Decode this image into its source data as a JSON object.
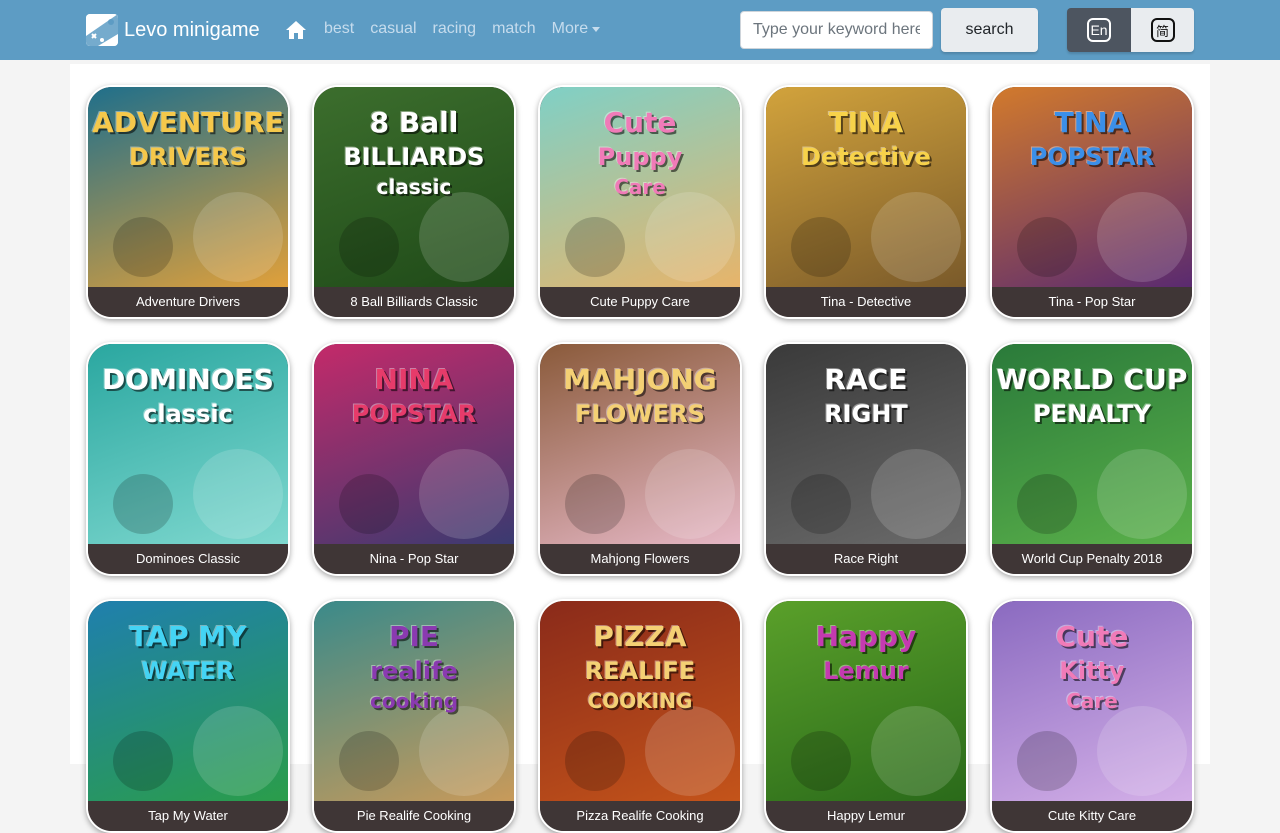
{
  "navbar": {
    "brand": "Levo minigame",
    "links": [
      "best",
      "casual",
      "racing",
      "match"
    ],
    "more_label": "More",
    "search_placeholder": "Type your keyword here",
    "search_button": "search",
    "lang_en": "En",
    "lang_zh": "简"
  },
  "games": [
    {
      "label": "Adventure Drivers",
      "art": [
        "ADVENTURE",
        "DRIVERS"
      ],
      "bg": "#1f6f8b",
      "bg2": "#e0a03a",
      "text_color": "#f5c84b"
    },
    {
      "label": "8 Ball Billiards Classic",
      "art": [
        "8 Ball",
        "BILLIARDS",
        "classic"
      ],
      "bg": "#3c6e2d",
      "bg2": "#1f4a18",
      "text_color": "#ffffff"
    },
    {
      "label": "Cute Puppy Care",
      "art": [
        "Cute",
        "Puppy",
        "Care"
      ],
      "bg": "#7fd0c6",
      "bg2": "#e7b46a",
      "text_color": "#f07bb8"
    },
    {
      "label": "Tina - Detective",
      "art": [
        "TINA",
        "Detective"
      ],
      "bg": "#d2a33c",
      "bg2": "#7a5a2a",
      "text_color": "#f7d24a"
    },
    {
      "label": "Tina - Pop Star",
      "art": [
        "TINA",
        "POPSTAR"
      ],
      "bg": "#d27a2c",
      "bg2": "#5a2a70",
      "text_color": "#3b8fe8"
    },
    {
      "label": "Dominoes Classic",
      "art": [
        "DOMINOES",
        "classic"
      ],
      "bg": "#2aa7a0",
      "bg2": "#7fd8cf",
      "text_color": "#ffffff"
    },
    {
      "label": "Nina - Pop Star",
      "art": [
        "NINA",
        "POPSTAR"
      ],
      "bg": "#c42a6a",
      "bg2": "#3a3a70",
      "text_color": "#e63b6a"
    },
    {
      "label": "Mahjong Flowers",
      "art": [
        "MAHJONG",
        "FLOWERS"
      ],
      "bg": "#8a5a3a",
      "bg2": "#e6b8c6",
      "text_color": "#f4d074"
    },
    {
      "label": "Race Right",
      "art": [
        "RACE",
        "RIGHT"
      ],
      "bg": "#3a3a3a",
      "bg2": "#6a6a6a",
      "text_color": "#ffffff"
    },
    {
      "label": "World Cup Penalty 2018",
      "art": [
        "WORLD CUP",
        "PENALTY"
      ],
      "bg": "#2a7a3a",
      "bg2": "#5ab04a",
      "text_color": "#ffffff"
    },
    {
      "label": "Tap My Water",
      "art": [
        "TAP MY",
        "WATER"
      ],
      "bg": "#1f7fae",
      "bg2": "#2a9d4a",
      "text_color": "#44d4f4"
    },
    {
      "label": "Pie Realife Cooking",
      "art": [
        "PIE",
        "realife",
        "cooking"
      ],
      "bg": "#3a8a8a",
      "bg2": "#c89a5a",
      "text_color": "#8a3ab0"
    },
    {
      "label": "Pizza Realife Cooking",
      "art": [
        "PIZZA",
        "REALIFE",
        "COOKING"
      ],
      "bg": "#8a2a1a",
      "bg2": "#c4541a",
      "text_color": "#f4d074"
    },
    {
      "label": "Happy Lemur",
      "art": [
        "Happy",
        "Lemur"
      ],
      "bg": "#5aa02a",
      "bg2": "#2a6a1a",
      "text_color": "#c43ab0"
    },
    {
      "label": "Cute Kitty Care",
      "art": [
        "Cute",
        "Kitty",
        "Care"
      ],
      "bg": "#8a6ac0",
      "bg2": "#d4b0e8",
      "text_color": "#f07bb8"
    }
  ]
}
